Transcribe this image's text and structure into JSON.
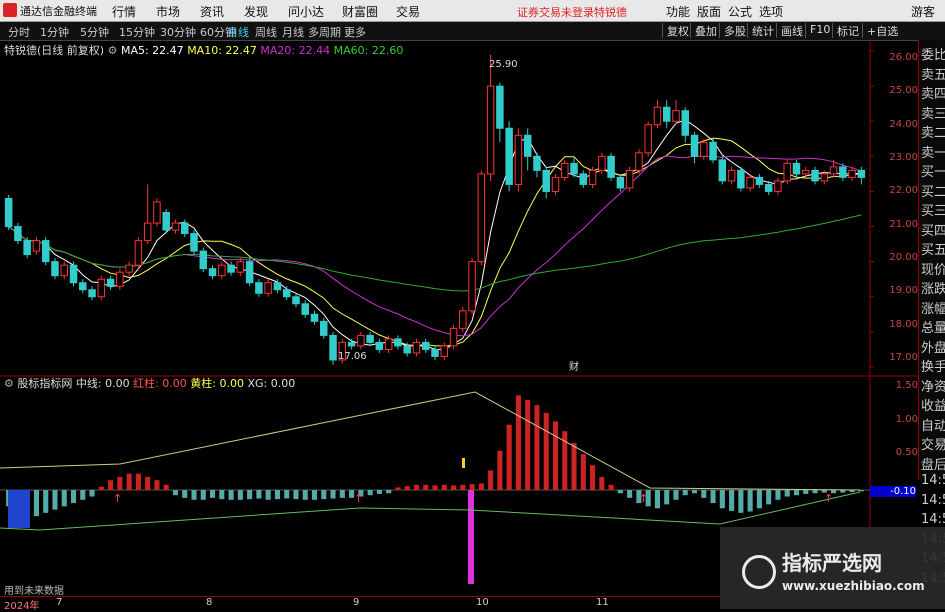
{
  "menubar": {
    "app_title": "通达信金融终端",
    "items": [
      "行情",
      "市场",
      "资讯",
      "发现",
      "问小达",
      "财富圈",
      "交易"
    ],
    "warning": "证券交易未登录",
    "stock_name": "特锐德",
    "right_items": [
      "功能",
      "版面",
      "公式",
      "选项"
    ],
    "guest": "游客"
  },
  "toolbar": {
    "periods": [
      "分时",
      "1分钟",
      "5分钟",
      "15分钟",
      "30分钟",
      "60分钟",
      "日线",
      "周线",
      "月线",
      "多周期",
      "更多"
    ],
    "active_period": "日线",
    "right_buttons": [
      "复权",
      "叠加",
      "多股",
      "统计",
      "画线",
      "F10",
      "标记",
      "+自选"
    ]
  },
  "main_info": {
    "title": "特锐德(日线 前复权)",
    "ma5": "MA5: 22.47",
    "ma10": "MA10: 22.47",
    "ma20": "MA20: 22.44",
    "ma60": "MA60: 22.60"
  },
  "price_axis": [
    "26.00",
    "25.00",
    "24.00",
    "23.00",
    "22.00",
    "21.00",
    "20.00",
    "19.00",
    "18.00",
    "17.00"
  ],
  "annotations": {
    "high": "25.90",
    "low": "17.06",
    "marker": "财"
  },
  "sub_info": {
    "title": "股标指标网",
    "zx": "中线: 0.00",
    "hz": "红柱: 0.00",
    "hzz": "黄柱: 0.00",
    "xg": "XG: 0.00"
  },
  "sub_axis": [
    "1.50",
    "1.00",
    "0.50"
  ],
  "sub_value_tag": "-0.10",
  "sidelist": [
    "委比",
    "卖五",
    "卖四",
    "卖三",
    "卖二",
    "卖一",
    "买一",
    "买二",
    "买三",
    "买四",
    "买五",
    "现价",
    "涨跌",
    "涨幅",
    "总量",
    "外盘",
    "换手",
    "净资",
    "收益",
    "自动",
    "交易",
    "盘后",
    "14:50",
    "14:50",
    "14:50",
    "14:50",
    "14:50",
    "14:50"
  ],
  "bottom_note": "用到未来数据",
  "x_axis": [
    "2024年",
    "7",
    "8",
    "9",
    "10",
    "11"
  ],
  "watermark": {
    "line1": "指标严选网",
    "line2": "www.xuezhibiao.com"
  },
  "colors": {
    "up": "#ff3333",
    "down": "#33cccc",
    "ma5": "#ffffff",
    "ma10": "#ffff55",
    "ma20": "#cc33cc",
    "ma60": "#33aa33",
    "magenta": "#dd33dd"
  },
  "chart_data": {
    "type": "candlestick",
    "y_range": [
      16.8,
      26.2
    ],
    "candles": [
      [
        21.8,
        21.0,
        21.9,
        20.9
      ],
      [
        21.0,
        20.6,
        21.1,
        20.5
      ],
      [
        20.6,
        20.2,
        20.7,
        20.1
      ],
      [
        20.3,
        20.6,
        20.7,
        20.2
      ],
      [
        20.6,
        20.0,
        20.7,
        19.9
      ],
      [
        20.0,
        19.6,
        20.1,
        19.5
      ],
      [
        19.6,
        19.9,
        20.0,
        19.5
      ],
      [
        19.9,
        19.4,
        20.0,
        19.3
      ],
      [
        19.4,
        19.2,
        19.5,
        19.1
      ],
      [
        19.2,
        19.0,
        19.3,
        18.9
      ],
      [
        19.0,
        19.5,
        19.6,
        18.9
      ],
      [
        19.5,
        19.3,
        19.6,
        19.2
      ],
      [
        19.3,
        19.7,
        19.8,
        19.2
      ],
      [
        19.7,
        19.9,
        20.0,
        19.6
      ],
      [
        19.9,
        20.6,
        20.7,
        19.8
      ],
      [
        20.6,
        21.1,
        22.2,
        20.5
      ],
      [
        21.1,
        21.7,
        21.8,
        21.0
      ],
      [
        21.4,
        20.9,
        21.5,
        20.8
      ],
      [
        20.9,
        21.1,
        21.2,
        20.8
      ],
      [
        21.1,
        20.8,
        21.2,
        20.7
      ],
      [
        20.8,
        20.3,
        20.9,
        20.2
      ],
      [
        20.3,
        19.8,
        20.4,
        19.7
      ],
      [
        19.8,
        19.6,
        19.9,
        19.5
      ],
      [
        19.6,
        19.9,
        20.0,
        19.5
      ],
      [
        19.9,
        19.7,
        20.0,
        19.6
      ],
      [
        19.7,
        20.0,
        20.1,
        19.6
      ],
      [
        20.0,
        19.4,
        20.1,
        19.3
      ],
      [
        19.4,
        19.1,
        19.5,
        19.0
      ],
      [
        19.1,
        19.4,
        19.5,
        19.0
      ],
      [
        19.4,
        19.2,
        19.5,
        19.1
      ],
      [
        19.2,
        19.0,
        19.3,
        18.9
      ],
      [
        19.0,
        18.8,
        19.1,
        18.7
      ],
      [
        18.8,
        18.5,
        18.9,
        18.4
      ],
      [
        18.5,
        18.3,
        18.6,
        18.2
      ],
      [
        18.3,
        17.9,
        18.4,
        17.8
      ],
      [
        17.9,
        17.2,
        18.0,
        17.06
      ],
      [
        17.2,
        17.7,
        17.8,
        17.1
      ],
      [
        17.7,
        17.6,
        17.8,
        17.5
      ],
      [
        17.6,
        17.9,
        18.0,
        17.5
      ],
      [
        17.9,
        17.7,
        18.0,
        17.6
      ],
      [
        17.7,
        17.5,
        17.8,
        17.4
      ],
      [
        17.5,
        17.8,
        17.9,
        17.4
      ],
      [
        17.8,
        17.6,
        17.9,
        17.5
      ],
      [
        17.6,
        17.4,
        17.7,
        17.3
      ],
      [
        17.4,
        17.7,
        17.8,
        17.3
      ],
      [
        17.7,
        17.5,
        17.8,
        17.4
      ],
      [
        17.5,
        17.3,
        17.6,
        17.2
      ],
      [
        17.3,
        17.6,
        17.7,
        17.2
      ],
      [
        17.6,
        18.1,
        18.2,
        17.5
      ],
      [
        18.1,
        18.6,
        18.7,
        18.0
      ],
      [
        18.6,
        20.0,
        20.1,
        18.5
      ],
      [
        20.0,
        22.5,
        22.6,
        19.9
      ],
      [
        22.5,
        25.0,
        25.9,
        22.3
      ],
      [
        25.0,
        23.8,
        25.1,
        23.4
      ],
      [
        23.8,
        22.2,
        24.0,
        22.0
      ],
      [
        22.2,
        23.6,
        23.8,
        22.0
      ],
      [
        23.6,
        23.0,
        23.8,
        22.6
      ],
      [
        23.0,
        22.6,
        23.1,
        22.4
      ],
      [
        22.6,
        22.0,
        22.7,
        21.8
      ],
      [
        22.0,
        22.4,
        22.5,
        21.9
      ],
      [
        22.4,
        22.8,
        22.9,
        22.3
      ],
      [
        22.8,
        22.5,
        23.0,
        22.4
      ],
      [
        22.5,
        22.2,
        22.6,
        22.1
      ],
      [
        22.2,
        22.6,
        22.7,
        22.1
      ],
      [
        22.6,
        23.0,
        23.1,
        22.5
      ],
      [
        23.0,
        22.4,
        23.1,
        22.3
      ],
      [
        22.4,
        22.1,
        22.5,
        22.0
      ],
      [
        22.1,
        22.6,
        22.7,
        22.0
      ],
      [
        22.6,
        23.1,
        23.2,
        22.5
      ],
      [
        23.1,
        23.9,
        24.0,
        23.0
      ],
      [
        23.9,
        24.4,
        24.6,
        23.8
      ],
      [
        24.4,
        24.0,
        24.6,
        23.8
      ],
      [
        24.0,
        24.3,
        24.6,
        23.9
      ],
      [
        24.3,
        23.6,
        24.4,
        23.4
      ],
      [
        23.6,
        23.0,
        23.7,
        22.8
      ],
      [
        23.0,
        23.4,
        23.5,
        22.9
      ],
      [
        23.4,
        22.9,
        23.5,
        22.8
      ],
      [
        22.9,
        22.3,
        23.0,
        22.2
      ],
      [
        22.3,
        22.6,
        22.7,
        22.2
      ],
      [
        22.6,
        22.1,
        22.7,
        22.0
      ],
      [
        22.1,
        22.4,
        22.5,
        22.0
      ],
      [
        22.4,
        22.2,
        22.5,
        22.1
      ],
      [
        22.2,
        22.0,
        22.3,
        21.9
      ],
      [
        22.0,
        22.3,
        22.4,
        21.9
      ],
      [
        22.3,
        22.8,
        22.9,
        22.2
      ],
      [
        22.8,
        22.5,
        22.9,
        22.4
      ],
      [
        22.5,
        22.6,
        22.7,
        22.4
      ],
      [
        22.6,
        22.3,
        22.7,
        22.2
      ],
      [
        22.3,
        22.5,
        22.6,
        22.2
      ],
      [
        22.5,
        22.7,
        22.9,
        22.4
      ],
      [
        22.7,
        22.4,
        22.8,
        22.3
      ],
      [
        22.4,
        22.6,
        22.7,
        22.3
      ],
      [
        22.6,
        22.4,
        22.7,
        22.2
      ]
    ],
    "sub_values": [
      -0.25,
      -0.4,
      -0.45,
      -0.4,
      -0.35,
      -0.3,
      -0.25,
      -0.2,
      -0.15,
      -0.1,
      0.05,
      0.15,
      0.2,
      0.25,
      0.25,
      0.2,
      0.15,
      0.08,
      -0.08,
      -0.12,
      -0.15,
      -0.15,
      -0.12,
      -0.14,
      -0.15,
      -0.15,
      -0.14,
      -0.13,
      -0.15,
      -0.14,
      -0.13,
      -0.14,
      -0.15,
      -0.15,
      -0.14,
      -0.13,
      -0.12,
      -0.12,
      -0.1,
      -0.08,
      -0.06,
      -0.05,
      0.04,
      0.06,
      0.08,
      0.08,
      0.07,
      0.08,
      0.07,
      0.08,
      0.09,
      0.1,
      0.3,
      0.6,
      1.0,
      1.45,
      1.38,
      1.3,
      1.18,
      1.05,
      0.9,
      0.72,
      0.55,
      0.38,
      0.2,
      0.08,
      -0.05,
      -0.12,
      -0.2,
      -0.25,
      -0.28,
      -0.22,
      -0.15,
      -0.08,
      -0.05,
      -0.12,
      -0.2,
      -0.28,
      -0.32,
      -0.35,
      -0.33,
      -0.28,
      -0.22,
      -0.15,
      -0.1,
      -0.08,
      -0.06,
      -0.05,
      -0.04,
      -0.05,
      -0.04,
      -0.03,
      -0.02
    ]
  }
}
